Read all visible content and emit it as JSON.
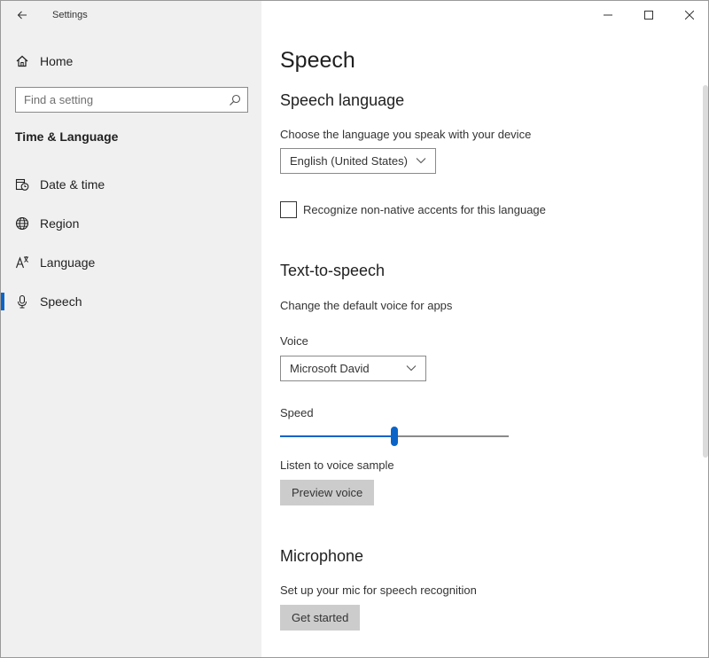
{
  "app": {
    "title": "Settings"
  },
  "sidebar": {
    "home_label": "Home",
    "search_placeholder": "Find a setting",
    "section_title": "Time & Language",
    "items": [
      {
        "label": "Date & time",
        "icon": "calendar-clock-icon",
        "active": false
      },
      {
        "label": "Region",
        "icon": "globe-icon",
        "active": false
      },
      {
        "label": "Language",
        "icon": "language-icon",
        "active": false
      },
      {
        "label": "Speech",
        "icon": "microphone-icon",
        "active": true
      }
    ]
  },
  "main": {
    "title": "Speech",
    "speech_language": {
      "heading": "Speech language",
      "description": "Choose the language you speak with your device",
      "selected_language": "English (United States)",
      "accents_checkbox_label": "Recognize non-native accents for this language",
      "accents_checked": false
    },
    "tts": {
      "heading": "Text-to-speech",
      "description": "Change the default voice for apps",
      "voice_label": "Voice",
      "selected_voice": "Microsoft David",
      "speed_label": "Speed",
      "speed_value": 0.5,
      "sample_label": "Listen to voice sample",
      "preview_button": "Preview voice"
    },
    "microphone": {
      "heading": "Microphone",
      "description": "Set up your mic for speech recognition",
      "button": "Get started"
    }
  },
  "colors": {
    "accent": "#0a64c8",
    "sidebar_bg": "#f0f0f0",
    "button_bg": "#cccccc"
  }
}
